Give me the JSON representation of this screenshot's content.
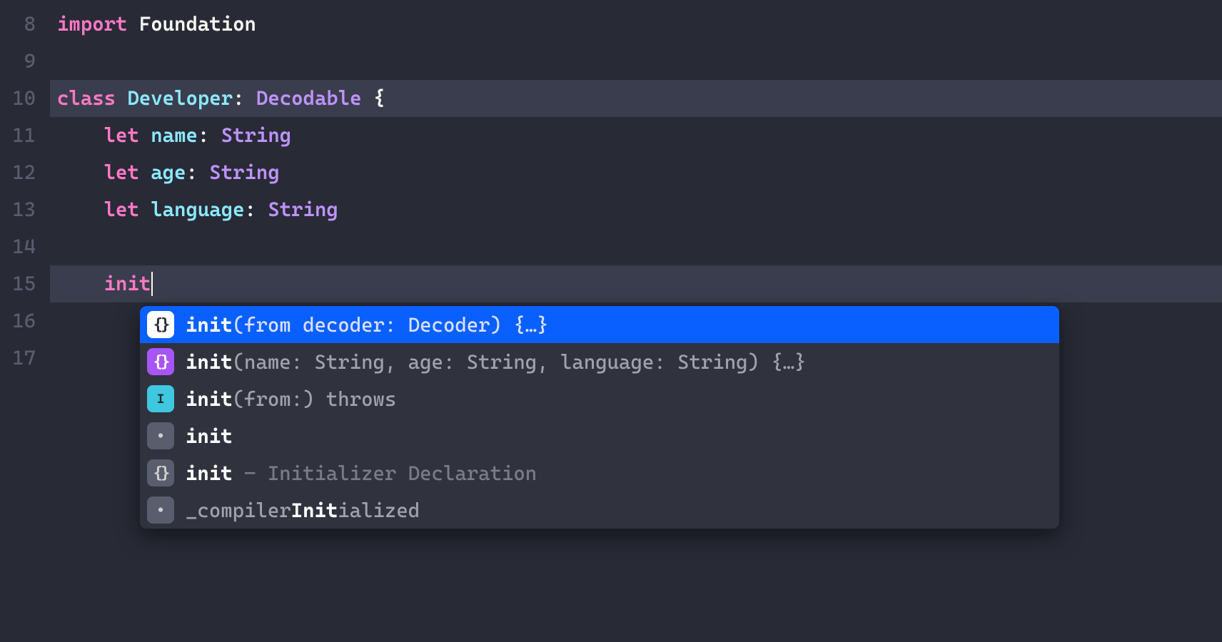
{
  "code": {
    "lines": [
      {
        "num": "8"
      },
      {
        "num": "9"
      },
      {
        "num": "10"
      },
      {
        "num": "11"
      },
      {
        "num": "12"
      },
      {
        "num": "13"
      },
      {
        "num": "14"
      },
      {
        "num": "15"
      },
      {
        "num": "16"
      },
      {
        "num": "17"
      }
    ],
    "line8": {
      "import": "import",
      "foundation": "Foundation"
    },
    "line10": {
      "class": "class",
      "developer": "Developer",
      "colon": ":",
      "decodable": "Decodable",
      "brace": "{"
    },
    "line11": {
      "let": "let",
      "name": "name",
      "colon": ":",
      "type": "String"
    },
    "line12": {
      "let": "let",
      "age": "age",
      "colon": ":",
      "type": "String"
    },
    "line13": {
      "let": "let",
      "language": "language",
      "colon": ":",
      "type": "String"
    },
    "line15": {
      "init": "init"
    }
  },
  "completion": {
    "items": [
      {
        "icon": "braces-white",
        "bold": "init",
        "rest": "(from decoder: Decoder) {…}"
      },
      {
        "icon": "braces-purple",
        "bold": "init",
        "rest": "(name: String, age: String, language: String) {…}"
      },
      {
        "icon": "info",
        "bold": "init",
        "rest": "(from:) throws"
      },
      {
        "icon": "dot",
        "bold": "init",
        "rest": ""
      },
      {
        "icon": "braces-gray",
        "bold": "init",
        "rest": " – Initializer Declaration"
      },
      {
        "icon": "dot",
        "plain_pre": "_compiler",
        "bold": "Init",
        "plain_post": "ialized"
      }
    ]
  }
}
